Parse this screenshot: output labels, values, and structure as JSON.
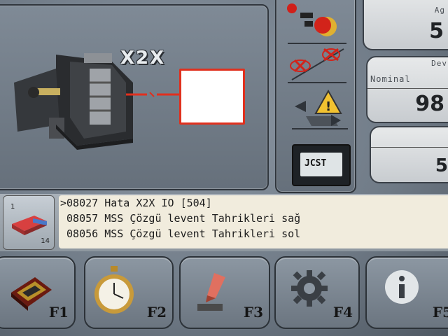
{
  "machine": {
    "title": "X2X"
  },
  "status_icons": {
    "controller_label": "JCST"
  },
  "stats": [
    {
      "label": "Ag",
      "value": "5"
    },
    {
      "label": "Nominal",
      "label_top": "Dev",
      "value": "98"
    },
    {
      "label": "",
      "value": "5"
    }
  ],
  "alarm_counter": {
    "top": "1",
    "bottom": "14"
  },
  "alarms": [
    {
      "text": ">08027 Hata X2X IO [504]"
    },
    {
      "text": " 08057 MSS Çözgü levent Tahrikleri sağ"
    },
    {
      "text": " 08056 MSS Çözgü levent Tahrikleri sol"
    }
  ],
  "function_keys": [
    {
      "label": "F1",
      "icon": "carpet-icon"
    },
    {
      "label": "F2",
      "icon": "stopwatch-icon"
    },
    {
      "label": "F3",
      "icon": "edit-hand-icon"
    },
    {
      "label": "F4",
      "icon": "gear-icon"
    },
    {
      "label": "F5",
      "icon": "info-icon"
    }
  ],
  "colors": {
    "alarm_red": "#e0301e",
    "warning_yellow": "#f2c230",
    "panel_bg": "#737e8a"
  }
}
